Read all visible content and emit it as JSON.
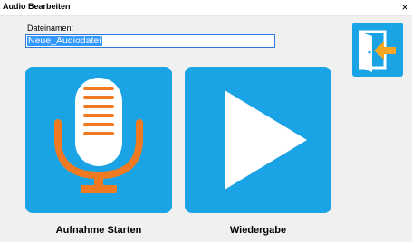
{
  "window": {
    "title": "Audio Bearbeiten",
    "close_glyph": "×"
  },
  "form": {
    "label": "Dateinamen:",
    "filename_value": "Neue_Audiodatei"
  },
  "actions": {
    "record_label": "Aufnahme Starten",
    "play_label": "Wiedergabe",
    "exit_icon": "exit-door-icon",
    "record_icon": "microphone-icon",
    "play_icon": "play-icon"
  },
  "colors": {
    "tile_blue": "#1aa3e5",
    "mic_orange": "#f07a22",
    "selection_blue": "#3399ff"
  }
}
